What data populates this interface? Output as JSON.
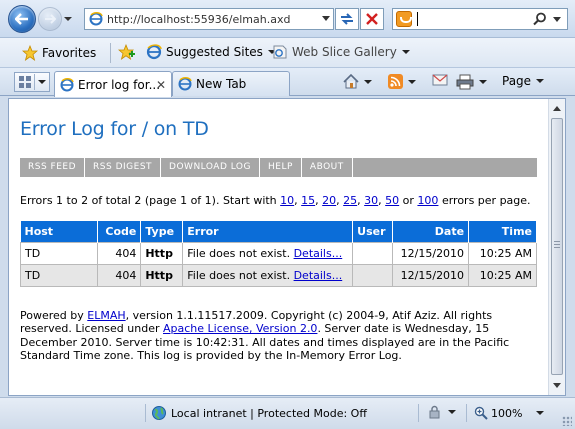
{
  "browser": {
    "address_url": "http://localhost:55936/elmah.axd",
    "favorites_label": "Favorites",
    "suggested_sites_label": "Suggested Sites",
    "web_slice_gallery_label": "Web Slice Gallery",
    "tabs": [
      {
        "label": "Error log for..."
      },
      {
        "label": "New Tab"
      }
    ],
    "page_menu_label": "Page",
    "status_zone_text": "Local intranet | Protected Mode: Off",
    "zoom_text": "100%"
  },
  "page": {
    "title": "Error Log for / on TD",
    "speedbar": [
      "RSS FEED",
      "RSS DIGEST",
      "DOWNLOAD LOG",
      "HELP",
      "ABOUT"
    ],
    "stats": {
      "prefix": "Errors 1 to 2 of total 2 (page 1 of 1). Start with",
      "page_sizes": [
        "10",
        "15",
        "20",
        "25",
        "30",
        "50",
        "100"
      ],
      "or_text": "or",
      "suffix": "errors per page."
    },
    "table": {
      "headers": {
        "host": "Host",
        "code": "Code",
        "type": "Type",
        "error": "Error",
        "user": "User",
        "date": "Date",
        "time": "Time"
      },
      "rows": [
        {
          "host": "TD",
          "code": "404",
          "type": "Http",
          "error": "File does not exist.",
          "details": "Details...",
          "user": "",
          "date": "12/15/2010",
          "time": "10:25 AM"
        },
        {
          "host": "TD",
          "code": "404",
          "type": "Http",
          "error": "File does not exist.",
          "details": "Details...",
          "user": "",
          "date": "12/15/2010",
          "time": "10:25 AM"
        }
      ]
    },
    "footer": {
      "part1": "Powered by",
      "elmah_link": "ELMAH",
      "part2": ", version 1.1.11517.2009. Copyright (c) 2004-9, Atif Aziz. All rights reserved. Licensed under",
      "license_link": "Apache License, Version 2.0",
      "part3": ". Server date is Wednesday, 15 December 2010. Server time is 10:42:31. All dates and times displayed are in the Pacific Standard Time zone. This log is provided by the In-Memory Error Log."
    }
  }
}
